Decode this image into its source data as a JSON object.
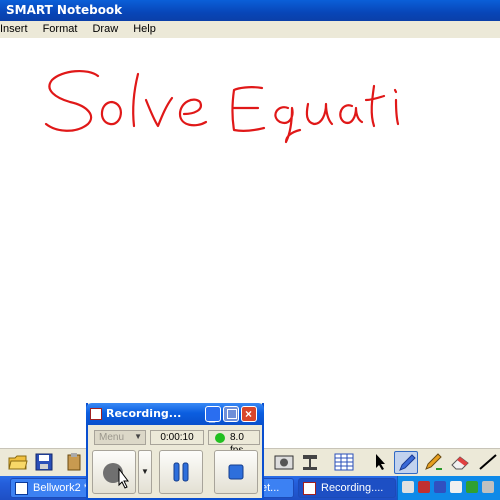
{
  "window": {
    "title": "SMART Notebook"
  },
  "menu": [
    "Insert",
    "Format",
    "Draw",
    "Help"
  ],
  "canvas": {
    "handwriting": "Solve Equati",
    "ink_color": "#e01818"
  },
  "recorder": {
    "title": "Recording...",
    "menu_label": "Menu",
    "elapsed": "0:00:10",
    "fps": "8.0 fps",
    "status_color": "#22c020"
  },
  "taskbar": {
    "items": [
      {
        "label": "Bellwork2 * ..."
      },
      {
        "label": "et..."
      },
      {
        "label": "Recording...."
      }
    ]
  },
  "toolbar": {
    "tools": [
      "open-icon",
      "save-icon",
      "paste-icon",
      "screen-capture-icon",
      "document-camera-icon",
      "table-icon",
      "select-arrow-icon",
      "pen-icon",
      "creative-pen-icon",
      "eraser-icon",
      "line-icon"
    ]
  }
}
